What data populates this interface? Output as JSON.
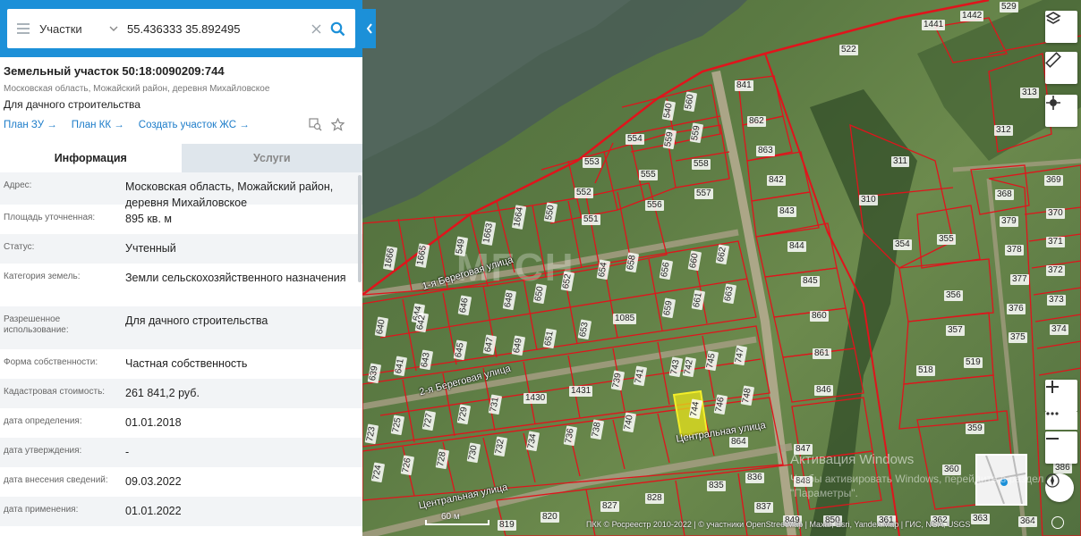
{
  "search": {
    "layer": "Участки",
    "query": "55.436333 35.892495"
  },
  "object": {
    "title": "Земельный участок 50:18:0090209:744",
    "address": "Московская область, Можайский район, деревня Михайловское",
    "use": "Для дачного строительства",
    "links": [
      "План ЗУ →",
      "План КК →",
      "Создать участок ЖС →"
    ]
  },
  "tabs": {
    "info": "Информация",
    "services": "Услуги"
  },
  "rows": [
    {
      "label": "Адрес:",
      "value": "Московская область, Можайский район, деревня Михайловское"
    },
    {
      "label": "Площадь уточненная:",
      "value": "895 кв. м"
    },
    {
      "label": "Статус:",
      "value": "Учтенный"
    },
    {
      "label": "Категория земель:",
      "value": "Земли сельскохозяйственного назначения"
    },
    {
      "label": "Разрешенное использование:",
      "value": "Для дачного строительства"
    },
    {
      "label": "Форма собственности:",
      "value": "Частная собственность"
    },
    {
      "label": "Кадастровая стоимость:",
      "value": "261 841,2 руб."
    },
    {
      "label": "дата определения:",
      "value": "01.01.2018"
    },
    {
      "label": "дата утверждения:",
      "value": "-"
    },
    {
      "label": "дата внесения сведений:",
      "value": "09.03.2022"
    },
    {
      "label": "дата применения:",
      "value": "01.01.2022"
    }
  ],
  "map": {
    "streets": [
      "1-я Береговая улица",
      "2-я Береговая улица",
      "Центральная улица",
      "Центральная улица"
    ],
    "scale": "60 м",
    "attribution": "ПКК © Росреестр 2010-2022 | © участники OpenStreetMap | Maxar, Esri, Yandex.Map | ГИС, NGA, USGS",
    "watermark_title": "Активация Windows",
    "watermark_text": "Чтобы активировать Windows, перейдите в раздел \"Параметры\".",
    "logo": "МГСН",
    "plots": [
      {
        "id": "529"
      },
      {
        "id": "1442"
      },
      {
        "id": "1441"
      },
      {
        "id": "522"
      },
      {
        "id": "841"
      },
      {
        "id": "313"
      },
      {
        "id": "862"
      },
      {
        "id": "312"
      },
      {
        "id": "540"
      },
      {
        "id": "560"
      },
      {
        "id": "554"
      },
      {
        "id": "559"
      },
      {
        "id": "559"
      },
      {
        "id": "863"
      },
      {
        "id": "553"
      },
      {
        "id": "555"
      },
      {
        "id": "558"
      },
      {
        "id": "842"
      },
      {
        "id": "311"
      },
      {
        "id": "369"
      },
      {
        "id": "368"
      },
      {
        "id": "552"
      },
      {
        "id": "556"
      },
      {
        "id": "557"
      },
      {
        "id": "310"
      },
      {
        "id": "843"
      },
      {
        "id": "379"
      },
      {
        "id": "370"
      },
      {
        "id": "550"
      },
      {
        "id": "1663"
      },
      {
        "id": "1664"
      },
      {
        "id": "551"
      },
      {
        "id": "354"
      },
      {
        "id": "355"
      },
      {
        "id": "371"
      },
      {
        "id": "1666"
      },
      {
        "id": "1665"
      },
      {
        "id": "549"
      },
      {
        "id": "844"
      },
      {
        "id": "378"
      },
      {
        "id": "372"
      },
      {
        "id": "658"
      },
      {
        "id": "656"
      },
      {
        "id": "660"
      },
      {
        "id": "662"
      },
      {
        "id": "654"
      },
      {
        "id": "652"
      },
      {
        "id": "845"
      },
      {
        "id": "377"
      },
      {
        "id": "650"
      },
      {
        "id": "648"
      },
      {
        "id": "646"
      },
      {
        "id": "663"
      },
      {
        "id": "661"
      },
      {
        "id": "356"
      },
      {
        "id": "373"
      },
      {
        "id": "376"
      },
      {
        "id": "644"
      },
      {
        "id": "642"
      },
      {
        "id": "640"
      },
      {
        "id": "1085"
      },
      {
        "id": "659"
      },
      {
        "id": "860"
      },
      {
        "id": "653"
      },
      {
        "id": "651"
      },
      {
        "id": "649"
      },
      {
        "id": "357"
      },
      {
        "id": "374"
      },
      {
        "id": "375"
      },
      {
        "id": "647"
      },
      {
        "id": "645"
      },
      {
        "id": "643"
      },
      {
        "id": "641"
      },
      {
        "id": "861"
      },
      {
        "id": "639"
      },
      {
        "id": "745"
      },
      {
        "id": "747"
      },
      {
        "id": "743"
      },
      {
        "id": "742"
      },
      {
        "id": "741"
      },
      {
        "id": "739"
      },
      {
        "id": "518"
      },
      {
        "id": "519"
      },
      {
        "id": "846"
      },
      {
        "id": "1431"
      },
      {
        "id": "1430"
      },
      {
        "id": "748"
      },
      {
        "id": "746"
      },
      {
        "id": "744"
      },
      {
        "id": "740"
      },
      {
        "id": "731"
      },
      {
        "id": "729"
      },
      {
        "id": "727"
      },
      {
        "id": "725"
      },
      {
        "id": "723"
      },
      {
        "id": "738"
      },
      {
        "id": "736"
      },
      {
        "id": "734"
      },
      {
        "id": "732"
      },
      {
        "id": "864"
      },
      {
        "id": "359"
      },
      {
        "id": "847"
      },
      {
        "id": "730"
      },
      {
        "id": "728"
      },
      {
        "id": "726"
      },
      {
        "id": "724"
      },
      {
        "id": "836"
      },
      {
        "id": "835"
      },
      {
        "id": "848"
      },
      {
        "id": "360"
      },
      {
        "id": "386"
      },
      {
        "id": "828"
      },
      {
        "id": "827"
      },
      {
        "id": "837"
      },
      {
        "id": "849"
      },
      {
        "id": "850"
      },
      {
        "id": "361"
      },
      {
        "id": "362"
      },
      {
        "id": "363"
      },
      {
        "id": "819"
      },
      {
        "id": "820"
      },
      {
        "id": "364"
      }
    ]
  },
  "colors": {
    "accent": "#1c90d8",
    "link": "#1c7cc9",
    "boundary": "#e0141c",
    "selected_plot": "#e6e21a"
  }
}
